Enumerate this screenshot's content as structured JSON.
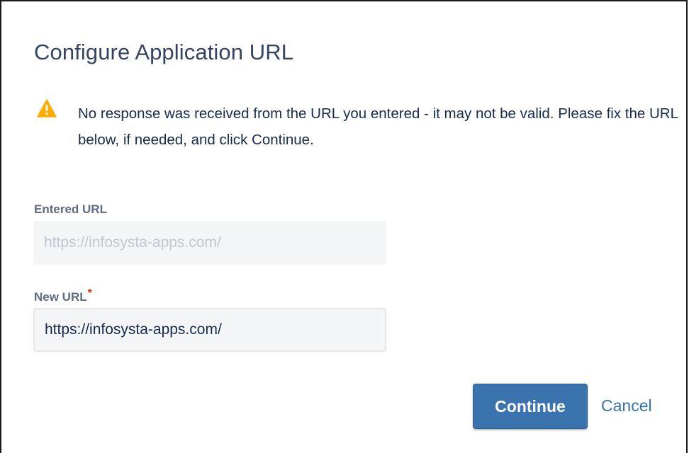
{
  "dialog": {
    "title": "Configure Application URL",
    "warning": {
      "icon": "warning-triangle-icon",
      "message": "No response was received from the URL you entered - it may not be valid. Please fix the URL below, if needed, and click Continue."
    },
    "entered_url": {
      "label": "Entered URL",
      "value": "https://infosysta-apps.com/"
    },
    "new_url": {
      "label": "New URL",
      "required_marker": "*",
      "value": "https://infosysta-apps.com/"
    },
    "buttons": {
      "continue_label": "Continue",
      "cancel_label": "Cancel"
    }
  },
  "colors": {
    "title": "#344563",
    "warning_icon": "#ffab00",
    "primary_button": "#3b73af",
    "link": "#3572b0",
    "required": "#de350b"
  }
}
